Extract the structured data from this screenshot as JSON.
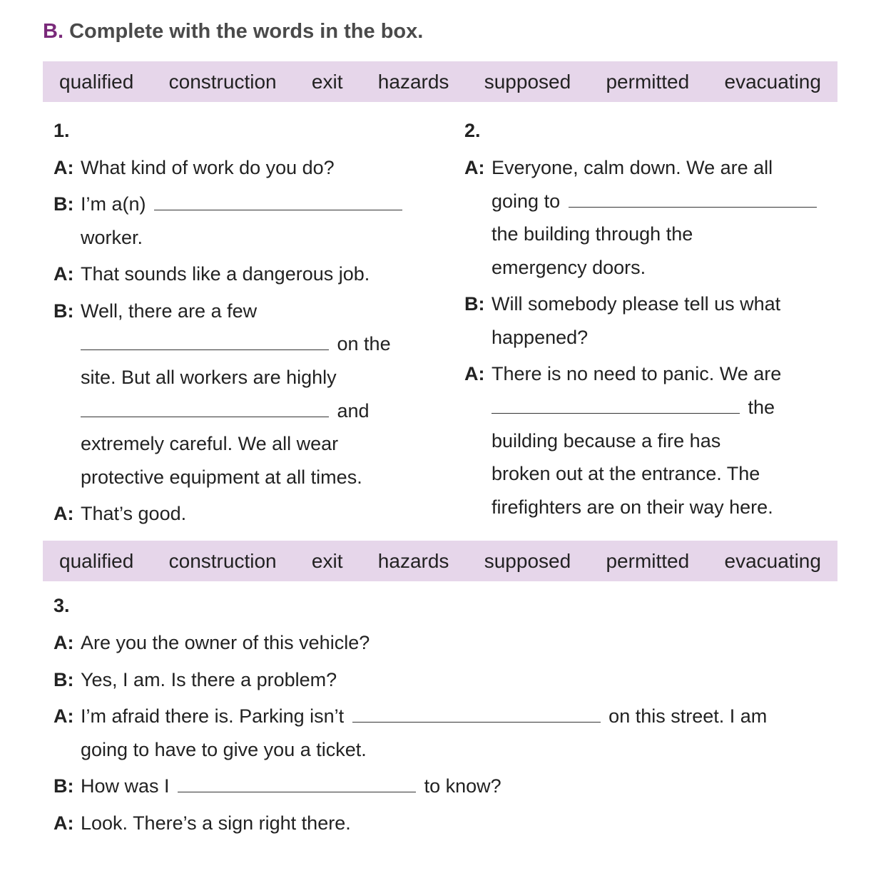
{
  "heading": {
    "letter": "B.",
    "text": "Complete with the words in the box."
  },
  "word_box": [
    "qualified",
    "construction",
    "exit",
    "hazards",
    "supposed",
    "permitted",
    "evacuating"
  ],
  "dialogue1": {
    "number": "1.",
    "lines": {
      "l1_spk": "A:",
      "l1": "What kind of work do you do?",
      "l2_spk": "B:",
      "l2a": "I’m a(n)",
      "l3": "worker.",
      "l4_spk": "A:",
      "l4": "That sounds like a dangerous job.",
      "l5_spk": "B:",
      "l5": "Well, there are a few",
      "l6": "on the",
      "l7": "site. But all workers are highly",
      "l8": "and",
      "l9": "extremely careful. We all wear",
      "l10": "protective equipment at all times.",
      "l11_spk": "A:",
      "l11": "That’s good."
    }
  },
  "dialogue2": {
    "number": "2.",
    "lines": {
      "l1_spk": "A:",
      "l1": "Everyone, calm down. We are all",
      "l2": "going to",
      "l3": "the building through the",
      "l4": "emergency doors.",
      "l5_spk": "B:",
      "l5": "Will somebody please tell us what",
      "l6": "happened?",
      "l7_spk": "A:",
      "l7": "There is no need to panic. We are",
      "l8": "the",
      "l9": "building because a fire has",
      "l10": "broken out at the entrance. The",
      "l11": "firefighters are on their way here."
    }
  },
  "dialogue3": {
    "number": "3.",
    "lines": {
      "l1_spk": "A:",
      "l1": "Are you the owner of this vehicle?",
      "l2_spk": "B:",
      "l2": "Yes, I am. Is there a problem?",
      "l3_spk": "A:",
      "l3a": "I’m afraid there is. Parking isn’t",
      "l3b": "on this street. I am",
      "l4": "going to have to give you a ticket.",
      "l5_spk": "B:",
      "l5a": "How was I",
      "l5b": "to know?",
      "l6_spk": "A:",
      "l6": "Look. There’s a sign right there."
    }
  }
}
